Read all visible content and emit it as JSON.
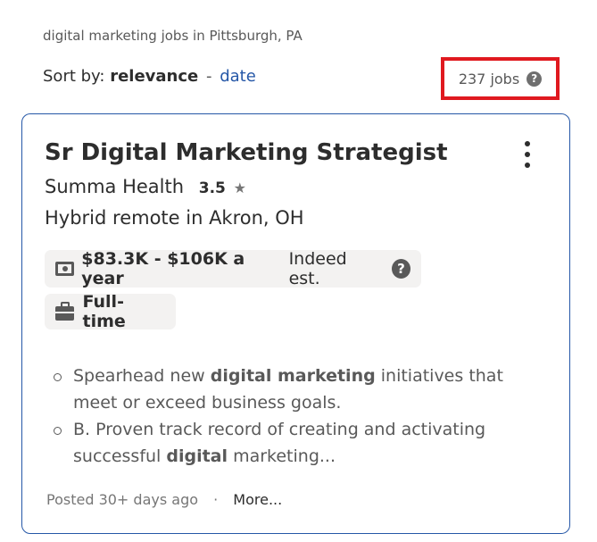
{
  "search": {
    "breadcrumb": "digital marketing jobs in Pittsburgh, PA",
    "sort_label": "Sort by:",
    "sort_active": "relevance",
    "sort_separator": "-",
    "sort_alt": "date",
    "job_count": "237 jobs",
    "highlight_color": "#e0191f"
  },
  "job": {
    "title": "Sr Digital Marketing Strategist",
    "company": "Summa Health",
    "rating": "3.5",
    "location": "Hybrid remote in Akron, OH",
    "salary": "$83.3K - $106K a year",
    "salary_note": "Indeed est.",
    "job_type": "Full-time",
    "snippet": [
      {
        "pre": "Spearhead new ",
        "bold": "digital marketing",
        "post": " initiatives that meet or exceed business goals."
      },
      {
        "pre": "B. Proven track record of creating and activating successful ",
        "bold": "digital",
        "post": " marketing..."
      }
    ],
    "posted": "Posted 30+ days ago",
    "footer_separator": "·",
    "more_link": "More...",
    "accent_color": "#2557a7"
  }
}
